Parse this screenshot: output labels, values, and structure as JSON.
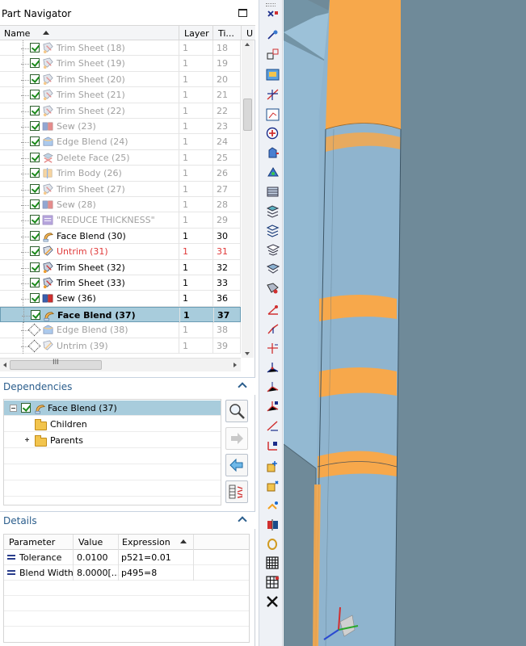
{
  "navigator": {
    "title": "Part Navigator",
    "columns": [
      "Name",
      "Layer",
      "Ti...",
      "U"
    ],
    "rows": [
      {
        "name": "Trim Sheet (18)",
        "layer": "1",
        "time": "18",
        "state": "dim",
        "icon": "trim-sheet-icon",
        "check": "checked"
      },
      {
        "name": "Trim Sheet (19)",
        "layer": "1",
        "time": "19",
        "state": "dim",
        "icon": "trim-sheet-icon",
        "check": "checked"
      },
      {
        "name": "Trim Sheet (20)",
        "layer": "1",
        "time": "20",
        "state": "dim",
        "icon": "trim-sheet-icon",
        "check": "checked"
      },
      {
        "name": "Trim Sheet (21)",
        "layer": "1",
        "time": "21",
        "state": "dim",
        "icon": "trim-sheet-icon",
        "check": "checked"
      },
      {
        "name": "Trim Sheet (22)",
        "layer": "1",
        "time": "22",
        "state": "dim",
        "icon": "trim-sheet-icon",
        "check": "checked"
      },
      {
        "name": "Sew (23)",
        "layer": "1",
        "time": "23",
        "state": "dim",
        "icon": "sew-icon",
        "check": "checked"
      },
      {
        "name": "Edge Blend (24)",
        "layer": "1",
        "time": "24",
        "state": "dim",
        "icon": "edge-blend-icon",
        "check": "checked"
      },
      {
        "name": "Delete Face (25)",
        "layer": "1",
        "time": "25",
        "state": "dim",
        "icon": "delete-face-icon",
        "check": "checked"
      },
      {
        "name": "Trim Body (26)",
        "layer": "1",
        "time": "26",
        "state": "dim",
        "icon": "trim-body-icon",
        "check": "checked"
      },
      {
        "name": "Trim Sheet (27)",
        "layer": "1",
        "time": "27",
        "state": "dim",
        "icon": "trim-sheet-icon",
        "check": "checked"
      },
      {
        "name": "Sew (28)",
        "layer": "1",
        "time": "28",
        "state": "dim",
        "icon": "sew-icon",
        "check": "checked"
      },
      {
        "name": "\"REDUCE THICKNESS\"",
        "layer": "1",
        "time": "29",
        "state": "dim",
        "icon": "reduce-thickness-icon",
        "check": "checked"
      },
      {
        "name": "Face Blend (30)",
        "layer": "1",
        "time": "30",
        "state": "normal",
        "icon": "face-blend-icon",
        "check": "checked"
      },
      {
        "name": "Untrim (31)",
        "layer": "1",
        "time": "31",
        "state": "red",
        "icon": "untrim-icon",
        "check": "checked"
      },
      {
        "name": "Trim Sheet (32)",
        "layer": "1",
        "time": "32",
        "state": "normal",
        "icon": "trim-sheet-icon",
        "check": "checked"
      },
      {
        "name": "Trim Sheet (33)",
        "layer": "1",
        "time": "33",
        "state": "normal",
        "icon": "trim-sheet-icon",
        "check": "checked"
      },
      {
        "name": "Sew (36)",
        "layer": "1",
        "time": "36",
        "state": "normal",
        "icon": "sew-icon",
        "check": "checked"
      },
      {
        "name": "Face Blend (37)",
        "layer": "1",
        "time": "37",
        "state": "selected",
        "icon": "face-blend-icon",
        "check": "checked"
      },
      {
        "name": "Edge Blend (38)",
        "layer": "1",
        "time": "38",
        "state": "dim",
        "icon": "edge-blend-icon",
        "check": "suppressed"
      },
      {
        "name": "Untrim (39)",
        "layer": "1",
        "time": "39",
        "state": "dim",
        "icon": "untrim-icon",
        "check": "suppressed"
      }
    ],
    "hscroll_thumb_glyph": "III"
  },
  "dependencies": {
    "title": "Dependencies",
    "items": [
      {
        "label": "Face Blend (37)"
      },
      {
        "label": "Children"
      },
      {
        "label": "Parents"
      }
    ]
  },
  "details": {
    "title": "Details",
    "columns": [
      "Parameter",
      "Value",
      "Expression"
    ],
    "rows": [
      {
        "parameter": "Tolerance",
        "value": "0.0100",
        "expression": "p521=0.01"
      },
      {
        "parameter": "Blend Width",
        "value": "8.0000[...",
        "expression": "p495=8"
      }
    ]
  },
  "colors": {
    "selection": "#a8ccdc",
    "section_title": "#2a5d8c",
    "viewport_bg": "#6f8a99",
    "surface_blue": "#8fb4ce",
    "blend_orange": "#f7a84b",
    "red_text": "#e03a3a"
  }
}
